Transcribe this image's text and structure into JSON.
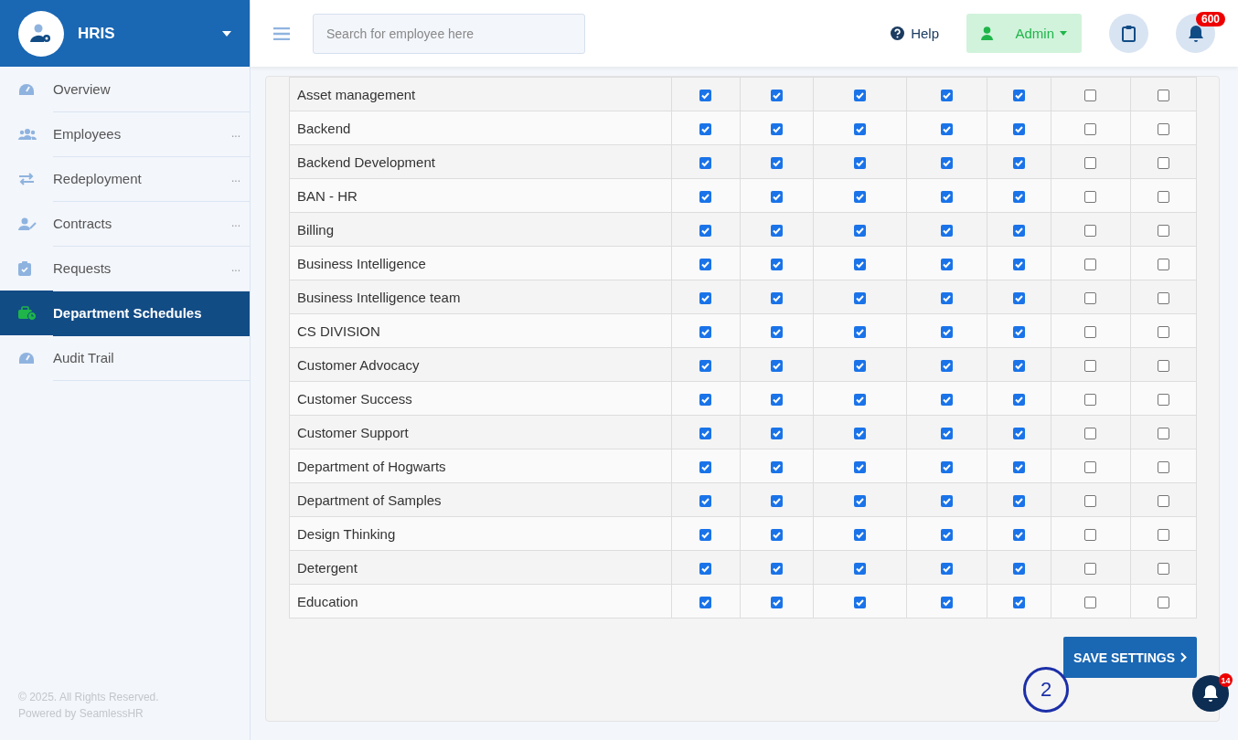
{
  "sidebar": {
    "brand": "HRIS",
    "items": [
      {
        "label": "Overview",
        "selected": false
      },
      {
        "label": "Employees",
        "selected": false,
        "more": "..."
      },
      {
        "label": "Redeployment",
        "selected": false,
        "more": "..."
      },
      {
        "label": "Contracts",
        "selected": false,
        "more": "..."
      },
      {
        "label": "Requests",
        "selected": false,
        "more": "..."
      },
      {
        "label": "Department Schedules",
        "selected": true
      },
      {
        "label": "Audit Trail",
        "selected": false
      }
    ],
    "footer": [
      "© 2025. All Rights Reserved.",
      "Powered by SeamlessHR"
    ]
  },
  "topbar": {
    "search": {
      "placeholder": "Search for employee here"
    },
    "help": "Help",
    "user": "Admin",
    "notifications": "600"
  },
  "table": {
    "rows": [
      {
        "name": "Asset management",
        "checks": [
          true,
          true,
          true,
          true,
          true,
          false,
          false
        ]
      },
      {
        "name": "Backend",
        "checks": [
          true,
          true,
          true,
          true,
          true,
          false,
          false
        ]
      },
      {
        "name": "Backend Development",
        "checks": [
          true,
          true,
          true,
          true,
          true,
          false,
          false
        ]
      },
      {
        "name": "BAN - HR",
        "checks": [
          true,
          true,
          true,
          true,
          true,
          false,
          false
        ]
      },
      {
        "name": "Billing",
        "checks": [
          true,
          true,
          true,
          true,
          true,
          false,
          false
        ]
      },
      {
        "name": "Business Intelligence",
        "checks": [
          true,
          true,
          true,
          true,
          true,
          false,
          false
        ]
      },
      {
        "name": "Business Intelligence team",
        "checks": [
          true,
          true,
          true,
          true,
          true,
          false,
          false
        ]
      },
      {
        "name": "CS DIVISION",
        "checks": [
          true,
          true,
          true,
          true,
          true,
          false,
          false
        ]
      },
      {
        "name": "Customer Advocacy",
        "checks": [
          true,
          true,
          true,
          true,
          true,
          false,
          false
        ]
      },
      {
        "name": "Customer Success",
        "checks": [
          true,
          true,
          true,
          true,
          true,
          false,
          false
        ]
      },
      {
        "name": "Customer Support",
        "checks": [
          true,
          true,
          true,
          true,
          true,
          false,
          false
        ]
      },
      {
        "name": "Department of Hogwarts",
        "checks": [
          true,
          true,
          true,
          true,
          true,
          false,
          false
        ]
      },
      {
        "name": "Department of Samples",
        "checks": [
          true,
          true,
          true,
          true,
          true,
          false,
          false
        ]
      },
      {
        "name": "Design Thinking",
        "checks": [
          true,
          true,
          true,
          true,
          true,
          false,
          false
        ]
      },
      {
        "name": "Detergent",
        "checks": [
          true,
          true,
          true,
          true,
          true,
          false,
          false
        ]
      },
      {
        "name": "Education",
        "checks": [
          true,
          true,
          true,
          true,
          true,
          false,
          false
        ]
      }
    ]
  },
  "save_button": "SAVE SETTINGS",
  "step_marker": "2",
  "chat_badge": "14"
}
